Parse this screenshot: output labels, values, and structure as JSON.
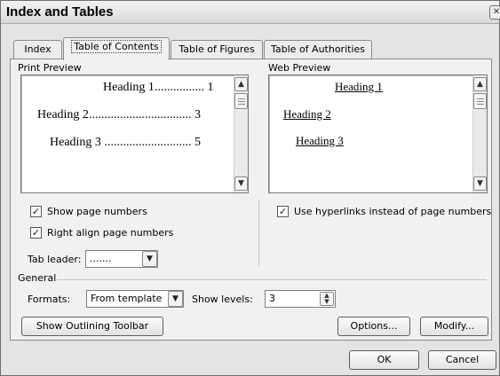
{
  "window": {
    "title": "Index and Tables",
    "close_glyph": "✕"
  },
  "tabs": [
    {
      "label": "Index",
      "selected": false
    },
    {
      "label": "Table of Contents",
      "selected": true
    },
    {
      "label": "Table of Figures",
      "selected": false
    },
    {
      "label": "Table of Authorities",
      "selected": false
    }
  ],
  "print_preview": {
    "label": "Print Preview",
    "lines": [
      {
        "text": "Heading 1",
        "leader": "................",
        "page": "1"
      },
      {
        "text": "Heading 2",
        "leader": ".................................",
        "page": "3"
      },
      {
        "text": "Heading 3",
        "leader": "............................",
        "page": "5"
      }
    ]
  },
  "web_preview": {
    "label": "Web Preview",
    "links": [
      "Heading 1",
      "Heading 2",
      "Heading 3"
    ]
  },
  "options": {
    "show_page_numbers": {
      "label": "Show page numbers",
      "checked": true
    },
    "right_align": {
      "label": "Right align page numbers",
      "checked": true
    },
    "use_hyperlinks": {
      "label": "Use hyperlinks instead of page numbers",
      "checked": true
    },
    "tab_leader": {
      "label": "Tab leader:",
      "value": "......."
    }
  },
  "general": {
    "label": "General",
    "formats_label": "Formats:",
    "formats_value": "From template",
    "show_levels_label": "Show levels:",
    "show_levels_value": "3"
  },
  "buttons": {
    "outlining": "Show Outlining Toolbar",
    "options": "Options...",
    "modify": "Modify...",
    "ok": "OK",
    "cancel": "Cancel"
  },
  "glyphs": {
    "check": "✓",
    "arrow_up": "▲",
    "arrow_down": "▼"
  }
}
